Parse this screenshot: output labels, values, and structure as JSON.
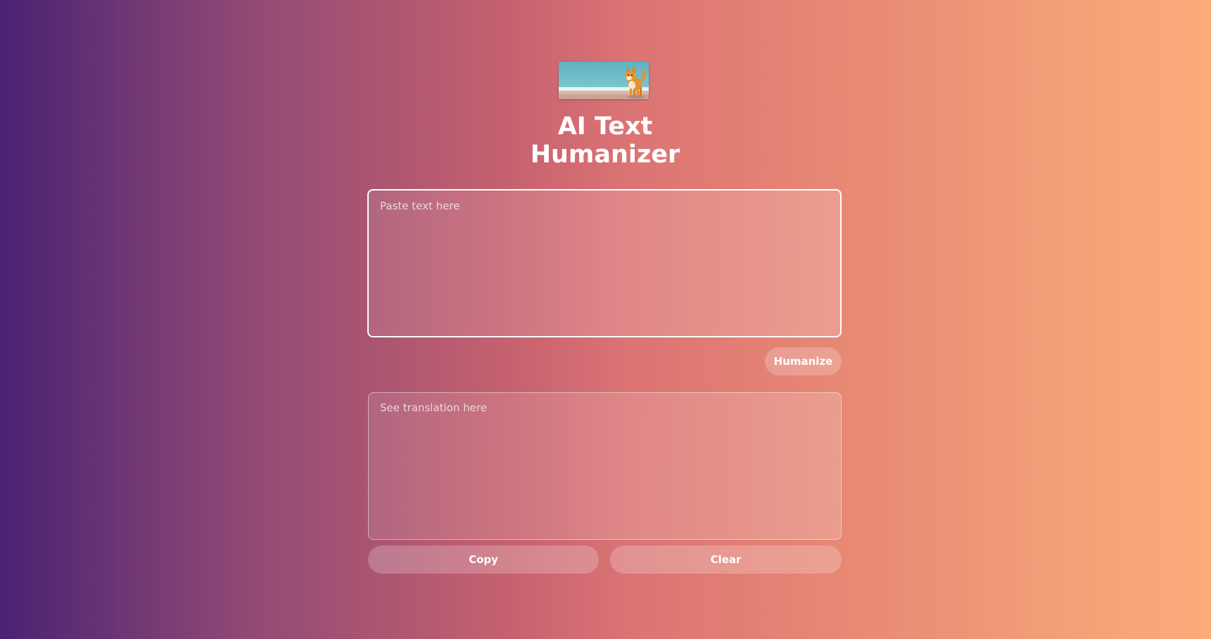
{
  "app": {
    "title": "AI Text Humanizer",
    "title_line1": "AI Text",
    "title_line2": "Humanizer",
    "logo_icon": "shiba-dog-on-beach-image"
  },
  "input": {
    "placeholder": "Paste text here",
    "value": ""
  },
  "actions": {
    "humanize_label": "Humanize",
    "copy_label": "Copy",
    "clear_label": "Clear"
  },
  "output": {
    "placeholder": "See translation here",
    "value": ""
  },
  "colors": {
    "gradient_start": "#4a2273",
    "gradient_mid": "#db7474",
    "gradient_end": "#fcaa79",
    "text": "#ffffff"
  }
}
